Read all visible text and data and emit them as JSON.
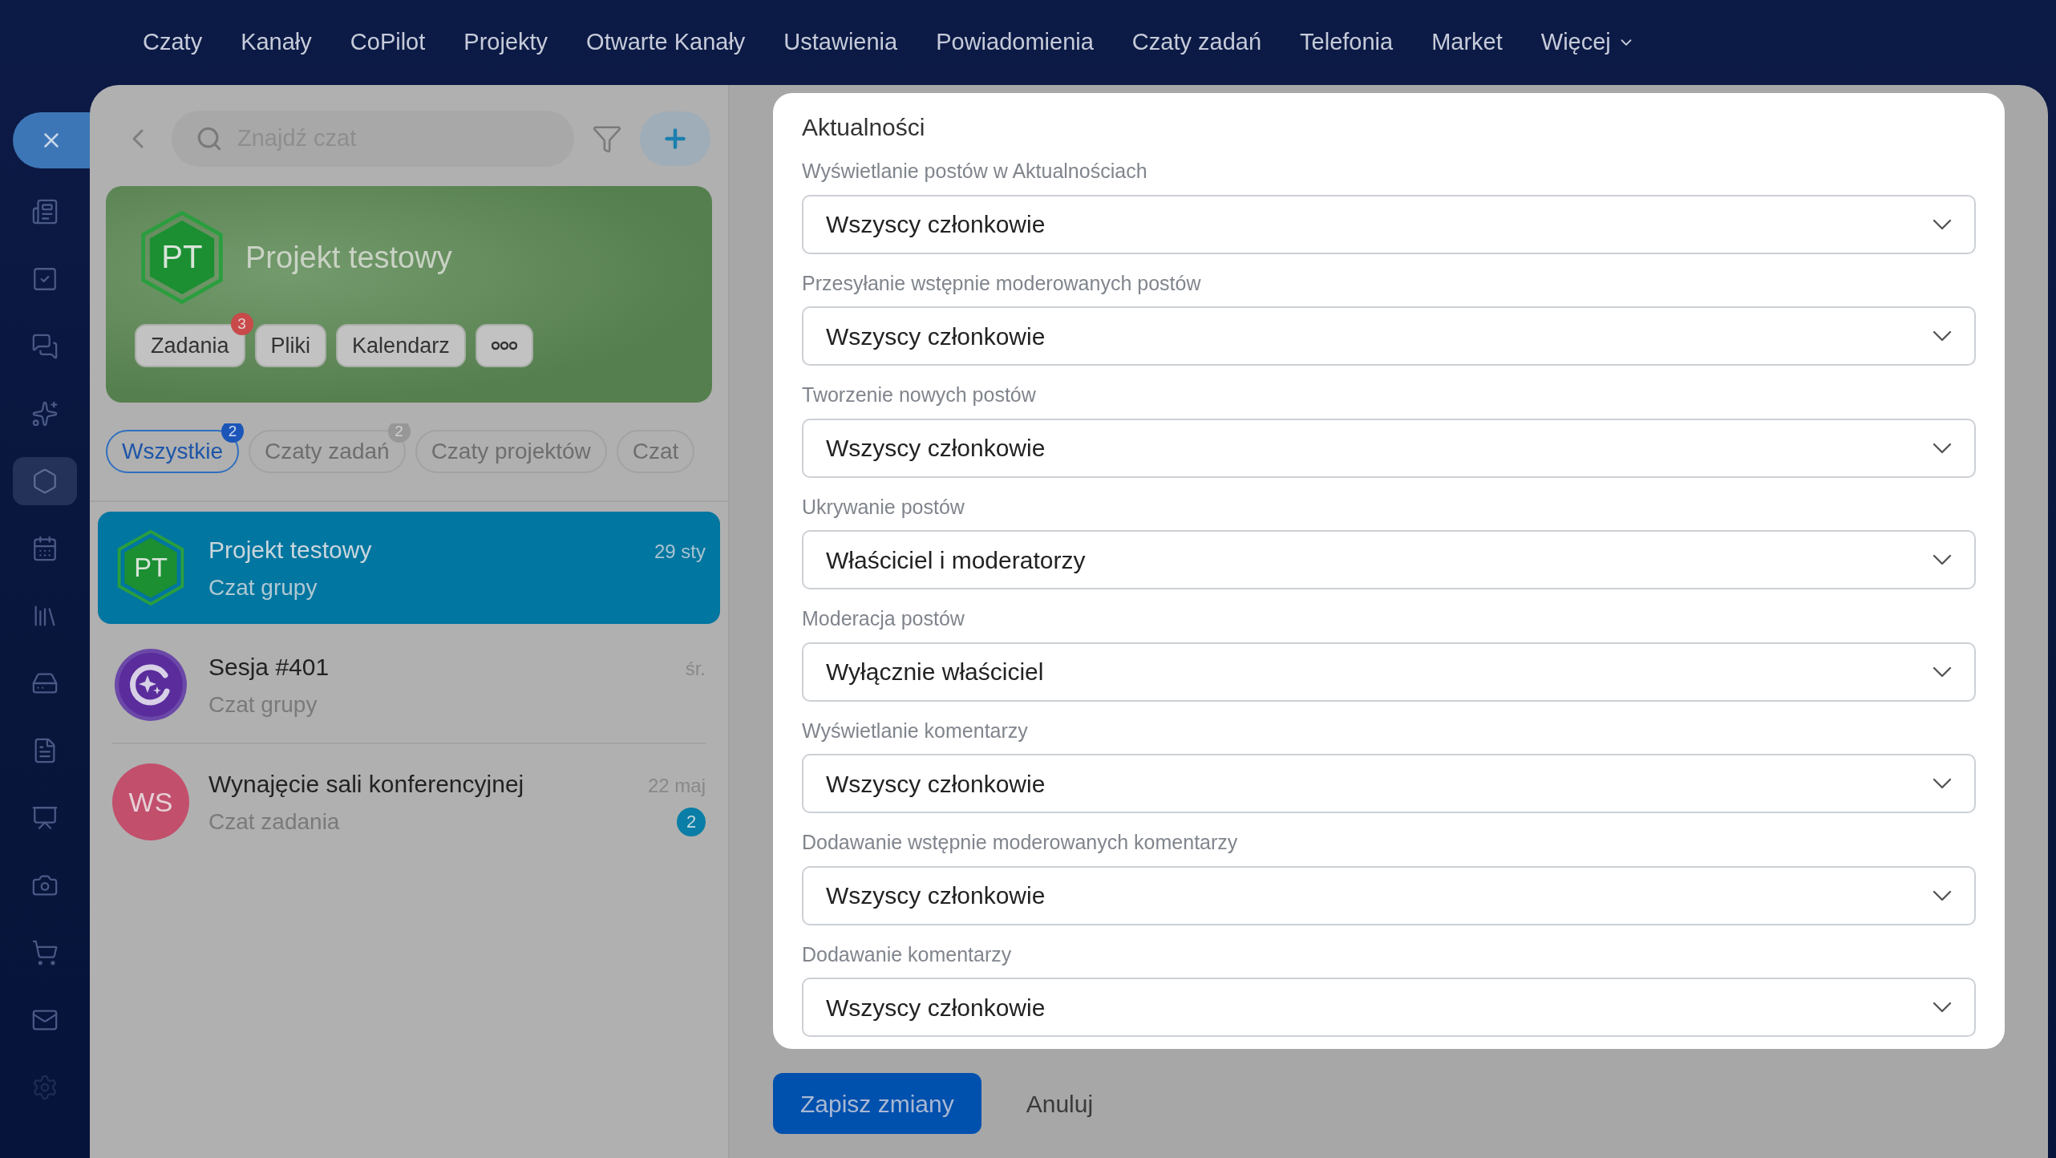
{
  "top_nav": [
    {
      "label": "Czaty"
    },
    {
      "label": "Kanały"
    },
    {
      "label": "CoPilot"
    },
    {
      "label": "Projekty"
    },
    {
      "label": "Otwarte Kanały"
    },
    {
      "label": "Ustawienia"
    },
    {
      "label": "Powiadomienia"
    },
    {
      "label": "Czaty zadań"
    },
    {
      "label": "Telefonia"
    },
    {
      "label": "Market"
    },
    {
      "label": "Więcej",
      "kind": "dropdown"
    }
  ],
  "rail": [
    {
      "kind": "close",
      "selected": false
    },
    {
      "kind": "news",
      "selected": false
    },
    {
      "kind": "tasks",
      "selected": false
    },
    {
      "kind": "chats",
      "selected": false
    },
    {
      "kind": "sparkle",
      "selected": false
    },
    {
      "kind": "hexagon",
      "selected": true
    },
    {
      "kind": "calendar",
      "selected": false
    },
    {
      "kind": "books",
      "selected": false
    },
    {
      "kind": "drive",
      "selected": false
    },
    {
      "kind": "file",
      "selected": false
    },
    {
      "kind": "board",
      "selected": false
    },
    {
      "kind": "camera",
      "selected": false
    },
    {
      "kind": "cart",
      "selected": false
    },
    {
      "kind": "mail",
      "selected": false
    },
    {
      "kind": "settings",
      "selected": false
    }
  ],
  "chat_panel": {
    "search": {
      "placeholder": "Znajdź czat"
    },
    "header": {
      "initials": "PT",
      "title": "Projekt testowy",
      "buttons": [
        {
          "kind": "text",
          "label": "Zadania",
          "badge": "3"
        },
        {
          "kind": "text",
          "label": "Pliki"
        },
        {
          "kind": "text",
          "label": "Kalendarz"
        },
        {
          "kind": "more"
        }
      ]
    },
    "filters": [
      {
        "label": "Wszystkie",
        "selected": true,
        "badge": "2"
      },
      {
        "label": "Czaty zadań",
        "selected": false,
        "badge": "2"
      },
      {
        "label": "Czaty projektów",
        "selected": false
      },
      {
        "label": "Czat",
        "selected": false
      }
    ],
    "chats": [
      {
        "kind": "hexagon",
        "initials": "PT",
        "title": "Projekt testowy",
        "subtitle": "Czat grupy",
        "date": "29 sty",
        "selected": true
      },
      {
        "kind": "logo",
        "title": "Sesja #401",
        "subtitle": "Czat grupy",
        "date": "śr.",
        "selected": false
      },
      {
        "kind": "initials",
        "initials": "WS",
        "color": "#c24f6c",
        "title": "Wynajęcie sali konferencyjnej",
        "subtitle": "Czat zadania",
        "date": "22 maj",
        "unread": "2",
        "selected": false
      }
    ]
  },
  "settings": {
    "title": "Aktualności",
    "fields": [
      {
        "label": "Wyświetlanie postów w Aktualnościach",
        "value": "Wszyscy członkowie"
      },
      {
        "label": "Przesyłanie wstępnie moderowanych postów",
        "value": "Wszyscy członkowie"
      },
      {
        "label": "Tworzenie nowych postów",
        "value": "Wszyscy członkowie"
      },
      {
        "label": "Ukrywanie postów",
        "value": "Właściciel i moderatorzy"
      },
      {
        "label": "Moderacja postów",
        "value": "Wyłącznie właściciel"
      },
      {
        "label": "Wyświetlanie komentarzy",
        "value": "Wszyscy członkowie"
      },
      {
        "label": "Dodawanie wstępnie moderowanych komentarzy",
        "value": "Wszyscy członkowie"
      },
      {
        "label": "Dodawanie komentarzy",
        "value": "Wszyscy członkowie"
      }
    ]
  },
  "actions": {
    "save": "Zapisz zmiany",
    "cancel": "Anuluj"
  }
}
